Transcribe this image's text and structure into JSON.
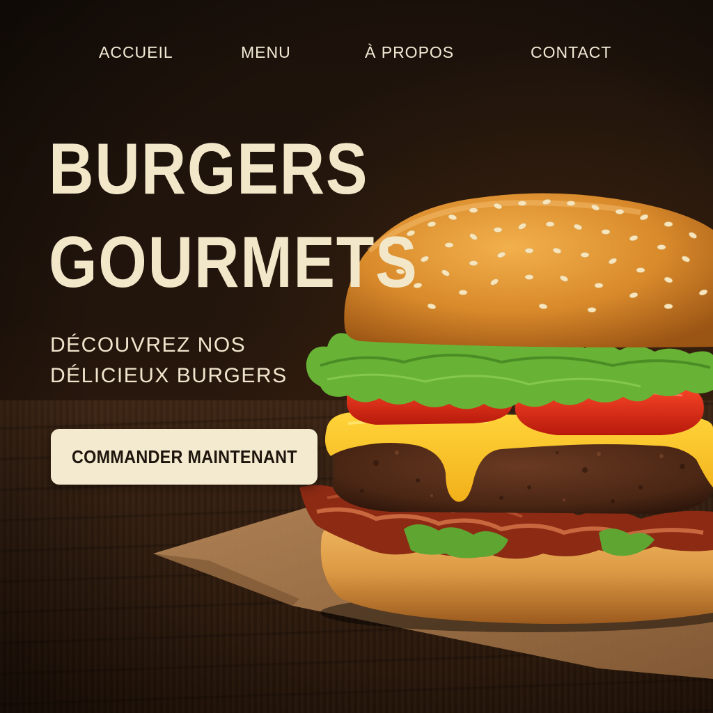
{
  "nav": {
    "items": [
      {
        "label": "ACCUEIL"
      },
      {
        "label": "MENU"
      },
      {
        "label": "À PROPOS"
      },
      {
        "label": "CONTACT"
      }
    ]
  },
  "hero": {
    "title_line1": "BURGERS",
    "title_line2": "GOURMETS",
    "subtitle_line1": "DÉCOUVREZ NOS",
    "subtitle_line2": "DÉLICIEUX BURGERS",
    "cta_label": "COMMANDER MAINTENANT"
  },
  "colors": {
    "background": "#1c120b",
    "cream": "#f2e7c9",
    "button_bg": "#f4ead0",
    "button_text": "#1e150d"
  }
}
